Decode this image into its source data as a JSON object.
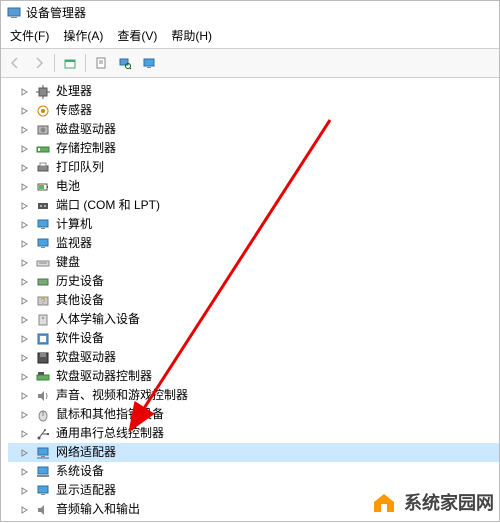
{
  "window": {
    "title": "设备管理器"
  },
  "menu": {
    "file": "文件(F)",
    "action": "操作(A)",
    "view": "查看(V)",
    "help": "帮助(H)"
  },
  "toolbar": {
    "back": "back",
    "forward": "forward",
    "up": "up",
    "properties": "properties",
    "scan": "scan",
    "monitor": "monitor"
  },
  "tree": {
    "nodes": [
      {
        "label": "处理器",
        "icon": "cpu",
        "selected": false
      },
      {
        "label": "传感器",
        "icon": "sensor",
        "selected": false
      },
      {
        "label": "磁盘驱动器",
        "icon": "disk",
        "selected": false
      },
      {
        "label": "存储控制器",
        "icon": "storage",
        "selected": false
      },
      {
        "label": "打印队列",
        "icon": "printer",
        "selected": false
      },
      {
        "label": "电池",
        "icon": "battery",
        "selected": false
      },
      {
        "label": "端口 (COM 和 LPT)",
        "icon": "port",
        "selected": false
      },
      {
        "label": "计算机",
        "icon": "computer",
        "selected": false
      },
      {
        "label": "监视器",
        "icon": "monitor",
        "selected": false
      },
      {
        "label": "键盘",
        "icon": "keyboard",
        "selected": false
      },
      {
        "label": "历史设备",
        "icon": "history",
        "selected": false
      },
      {
        "label": "其他设备",
        "icon": "other",
        "selected": false
      },
      {
        "label": "人体学输入设备",
        "icon": "hid",
        "selected": false
      },
      {
        "label": "软件设备",
        "icon": "software",
        "selected": false
      },
      {
        "label": "软盘驱动器",
        "icon": "floppy",
        "selected": false
      },
      {
        "label": "软盘驱动器控制器",
        "icon": "floppyctrl",
        "selected": false
      },
      {
        "label": "声音、视频和游戏控制器",
        "icon": "audio",
        "selected": false
      },
      {
        "label": "鼠标和其他指针设备",
        "icon": "mouse",
        "selected": false
      },
      {
        "label": "通用串行总线控制器",
        "icon": "usb",
        "selected": false
      },
      {
        "label": "网络适配器",
        "icon": "network",
        "selected": true
      },
      {
        "label": "系统设备",
        "icon": "system",
        "selected": false
      },
      {
        "label": "显示适配器",
        "icon": "display",
        "selected": false
      },
      {
        "label": "音频输入和输出",
        "icon": "audioio",
        "selected": false
      }
    ]
  },
  "watermark": {
    "text": "系统家园网"
  }
}
